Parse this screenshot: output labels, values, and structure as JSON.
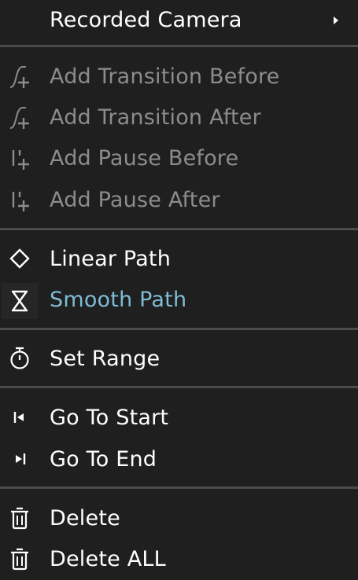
{
  "menu": {
    "items": [
      {
        "label": "Recorded Camera",
        "icon": "submenu",
        "state": "normal"
      },
      {
        "label": "Add Transition Before",
        "icon": "transition-add-icon",
        "state": "disabled"
      },
      {
        "label": "Add Transition After",
        "icon": "transition-add-icon",
        "state": "disabled"
      },
      {
        "label": "Add Pause Before",
        "icon": "pause-add-icon",
        "state": "disabled"
      },
      {
        "label": "Add Pause After",
        "icon": "pause-add-icon",
        "state": "disabled"
      },
      {
        "label": "Linear Path",
        "icon": "diamond-icon",
        "state": "normal"
      },
      {
        "label": "Smooth Path",
        "icon": "hourglass-icon",
        "state": "active"
      },
      {
        "label": "Set Range",
        "icon": "stopwatch-icon",
        "state": "normal"
      },
      {
        "label": "Go To Start",
        "icon": "go-to-start-icon",
        "state": "normal"
      },
      {
        "label": "Go To End",
        "icon": "go-to-end-icon",
        "state": "normal"
      },
      {
        "label": "Delete",
        "icon": "trash-icon",
        "state": "normal"
      },
      {
        "label": "Delete ALL",
        "icon": "trash-icon",
        "state": "normal"
      }
    ]
  },
  "colors": {
    "background": "#1f1f1f",
    "text": "#ffffff",
    "disabled_text": "#8c8c8c",
    "active_text": "#7fbcd6",
    "separator": "#4b4b4b"
  }
}
